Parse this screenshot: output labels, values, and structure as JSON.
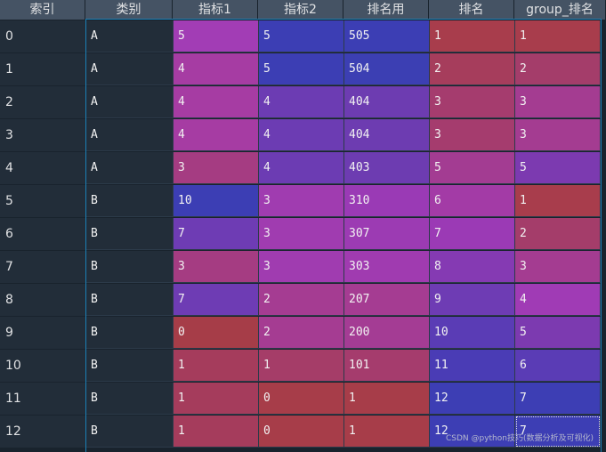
{
  "columns": {
    "index": "索引",
    "category": "类别",
    "metric1": "指标1",
    "metric2": "指标2",
    "rank_value": "排名用",
    "rank": "排名",
    "group_rank": "group_排名"
  },
  "rows": [
    {
      "index": "0",
      "category": "A",
      "metric1": "5",
      "metric2": "5",
      "rank_value": "505",
      "rank": "1",
      "group_rank": "1",
      "colors": [
        "#a23db5",
        "#3c3eb4",
        "#3c3eb4",
        "#a83d4c",
        "#a83d4c"
      ]
    },
    {
      "index": "1",
      "category": "A",
      "metric1": "4",
      "metric2": "5",
      "rank_value": "504",
      "rank": "2",
      "group_rank": "2",
      "colors": [
        "#a63ca3",
        "#3c3eb4",
        "#3c3fb3",
        "#a63d5c",
        "#a43d6a"
      ]
    },
    {
      "index": "2",
      "category": "A",
      "metric1": "4",
      "metric2": "4",
      "rank_value": "404",
      "rank": "3",
      "group_rank": "3",
      "colors": [
        "#a63ca3",
        "#6c3cb3",
        "#6d3cb1",
        "#a53c6e",
        "#a43c91"
      ]
    },
    {
      "index": "3",
      "category": "A",
      "metric1": "4",
      "metric2": "4",
      "rank_value": "404",
      "rank": "3",
      "group_rank": "3",
      "colors": [
        "#a63ca3",
        "#6c3cb3",
        "#6d3cb1",
        "#a53c6e",
        "#a43c91"
      ]
    },
    {
      "index": "4",
      "category": "A",
      "metric1": "3",
      "metric2": "4",
      "rank_value": "403",
      "rank": "5",
      "group_rank": "5",
      "colors": [
        "#a53c82",
        "#6c3cb3",
        "#6d3cb1",
        "#a33c92",
        "#7c3ab0"
      ]
    },
    {
      "index": "5",
      "category": "B",
      "metric1": "10",
      "metric2": "3",
      "rank_value": "310",
      "rank": "6",
      "group_rank": "1",
      "colors": [
        "#3c3eb4",
        "#a03cb0",
        "#9a3ab5",
        "#a33ba6",
        "#a83d4c"
      ]
    },
    {
      "index": "6",
      "category": "B",
      "metric1": "7",
      "metric2": "3",
      "rank_value": "307",
      "rank": "7",
      "group_rank": "2",
      "colors": [
        "#6e3cb4",
        "#a03cb0",
        "#9c3bb3",
        "#9b3ab5",
        "#a43d6a"
      ]
    },
    {
      "index": "7",
      "category": "B",
      "metric1": "3",
      "metric2": "3",
      "rank_value": "303",
      "rank": "8",
      "group_rank": "3",
      "colors": [
        "#a53c82",
        "#a03cb0",
        "#a03bb0",
        "#853ab3",
        "#a43c91"
      ]
    },
    {
      "index": "8",
      "category": "B",
      "metric1": "7",
      "metric2": "2",
      "rank_value": "207",
      "rank": "9",
      "group_rank": "4",
      "colors": [
        "#6e3cb4",
        "#a53c92",
        "#a53c92",
        "#6e3cb4",
        "#a03bb5"
      ]
    },
    {
      "index": "9",
      "category": "B",
      "metric1": "0",
      "metric2": "2",
      "rank_value": "200",
      "rank": "10",
      "group_rank": "5",
      "colors": [
        "#a63d48",
        "#a53c92",
        "#a43c94",
        "#5a3cb5",
        "#7c3ab0"
      ]
    },
    {
      "index": "10",
      "category": "B",
      "metric1": "1",
      "metric2": "1",
      "rank_value": "101",
      "rank": "11",
      "group_rank": "6",
      "colors": [
        "#a53c5c",
        "#a53d68",
        "#a53c6d",
        "#4a3cb5",
        "#5a3cb5"
      ]
    },
    {
      "index": "11",
      "category": "B",
      "metric1": "1",
      "metric2": "0",
      "rank_value": "1",
      "rank": "12",
      "group_rank": "7",
      "colors": [
        "#a53c5c",
        "#a73d49",
        "#a73d49",
        "#3d3eb4",
        "#3d3eb4"
      ]
    },
    {
      "index": "12",
      "category": "B",
      "metric1": "1",
      "metric2": "0",
      "rank_value": "1",
      "rank": "12",
      "group_rank": "7",
      "colors": [
        "#a53c5c",
        "#a73d49",
        "#a73d49",
        "#3d3eb4",
        "#3d3eb4"
      ]
    }
  ],
  "watermark": "CSDN @python技巧(数据分析及可视化)"
}
